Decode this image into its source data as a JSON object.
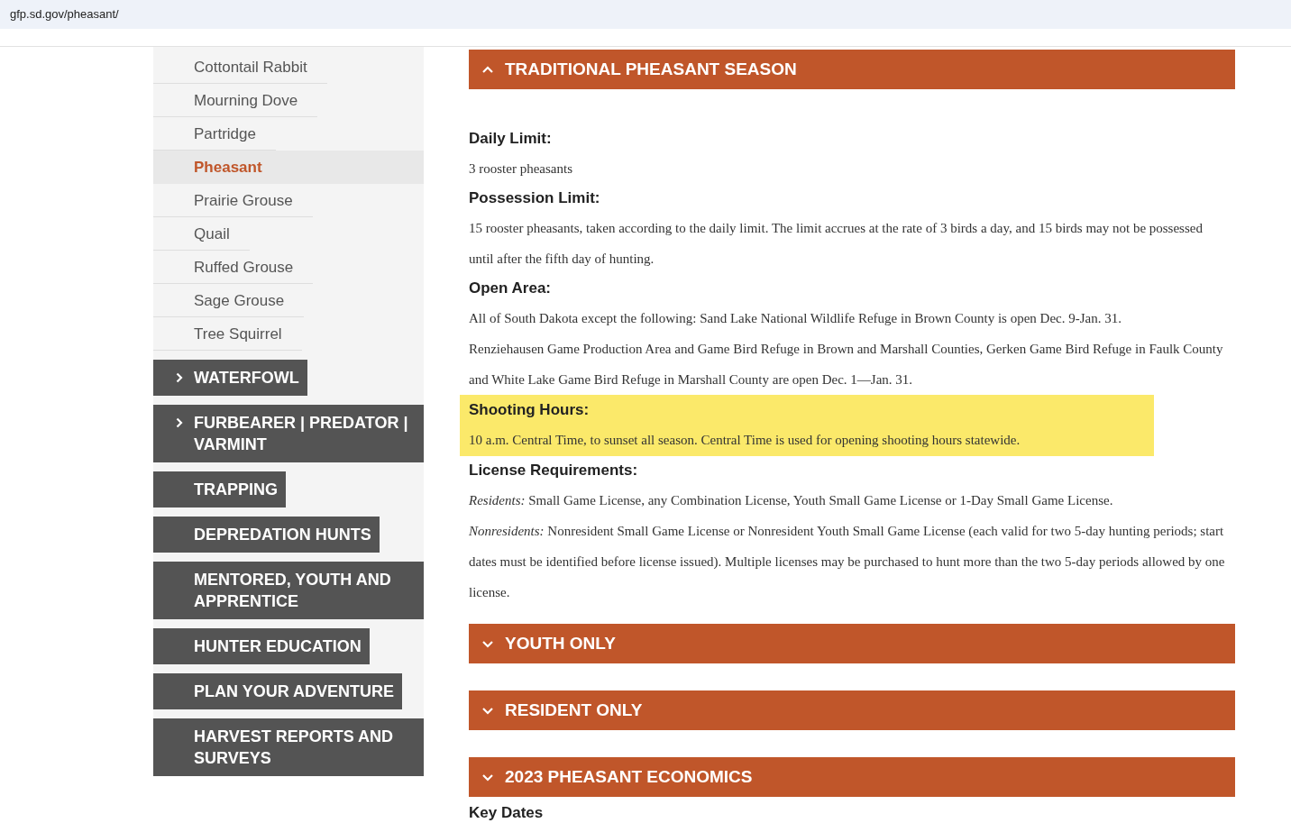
{
  "address_bar": {
    "url": "gfp.sd.gov/pheasant/"
  },
  "sidebar": {
    "sub_items": [
      {
        "label": "Cottontail Rabbit",
        "selected": false
      },
      {
        "label": "Mourning Dove",
        "selected": false
      },
      {
        "label": "Partridge",
        "selected": false
      },
      {
        "label": "Pheasant",
        "selected": true
      },
      {
        "label": "Prairie Grouse",
        "selected": false
      },
      {
        "label": "Quail",
        "selected": false
      },
      {
        "label": "Ruffed Grouse",
        "selected": false
      },
      {
        "label": "Sage Grouse",
        "selected": false
      },
      {
        "label": "Tree Squirrel",
        "selected": false
      }
    ],
    "nav": [
      {
        "label": "WATERFOWL",
        "has_submenu": true
      },
      {
        "label": "FURBEARER | PREDATOR | VARMINT",
        "has_submenu": true
      },
      {
        "label": "TRAPPING",
        "has_submenu": false
      },
      {
        "label": "DEPREDATION HUNTS",
        "has_submenu": false
      },
      {
        "label": "MENTORED, YOUTH AND APPRENTICE",
        "has_submenu": false
      },
      {
        "label": "HUNTER EDUCATION",
        "has_submenu": false
      },
      {
        "label": "PLAN YOUR ADVENTURE",
        "has_submenu": false
      },
      {
        "label": "HARVEST REPORTS AND SURVEYS",
        "has_submenu": false
      }
    ]
  },
  "accordions": [
    {
      "title": "TRADITIONAL PHEASANT SEASON",
      "expanded": true,
      "content": [
        {
          "heading": "Daily Limit:",
          "highlighted": false,
          "paragraphs": [
            "3 rooster pheasants"
          ]
        },
        {
          "heading": "Possession Limit:",
          "highlighted": false,
          "paragraphs": [
            "15 rooster pheasants, taken according to the daily limit. The limit accrues at the rate of 3 birds a day, and 15 birds may not be possessed until after the fifth day of hunting."
          ]
        },
        {
          "heading": "Open Area:",
          "highlighted": false,
          "paragraphs": [
            "All of South Dakota except the following: Sand Lake National Wildlife Refuge in Brown County is open Dec. 9-Jan. 31.",
            "Renziehausen Game Production Area and Game Bird Refuge in Brown and Marshall Counties, Gerken Game Bird Refuge in Faulk County and White Lake Game Bird Refuge in Marshall County are open Dec. 1—Jan. 31."
          ]
        },
        {
          "heading": "Shooting Hours:",
          "highlighted": true,
          "paragraphs": [
            "10 a.m. Central Time, to sunset all season. Central Time is used for opening shooting hours statewide."
          ]
        },
        {
          "heading": "License Requirements:",
          "highlighted": false,
          "paragraphs": [
            "*Residents:* Small Game License, any Combination License, Youth Small Game License or 1-Day Small Game License.",
            "*Nonresidents:* Nonresident Small Game License or Nonresident Youth Small Game License (each valid for two 5-day hunting periods; start dates must be identified before license issued). Multiple licenses may be purchased to hunt more than the two 5-day periods allowed by one license."
          ]
        }
      ]
    },
    {
      "title": "YOUTH ONLY",
      "expanded": false
    },
    {
      "title": "RESIDENT ONLY",
      "expanded": false
    },
    {
      "title": "2023 PHEASANT ECONOMICS",
      "expanded": false
    }
  ],
  "trailing_heading": "Key Dates"
}
